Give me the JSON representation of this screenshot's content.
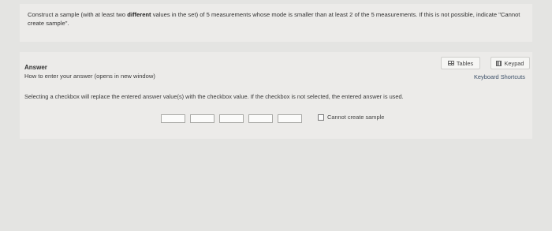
{
  "question": {
    "text_before_bold": "Construct a sample (with at least two ",
    "text_bold": "different",
    "text_after_bold": " values in the set) of 5 measurements whose mode is smaller than at least 2 of the 5 measurements.  If this is not possible, indicate \"Cannot create sample\"."
  },
  "answer": {
    "heading": "Answer",
    "howto_link": "How to enter your answer (opens in new window)",
    "tables_label": "Tables",
    "keypad_label": "Keypad",
    "keyboard_shortcuts": "Keyboard Shortcuts",
    "instructions": "Selecting a checkbox will replace the entered answer value(s) with the checkbox value. If the checkbox is not selected, the entered answer is used.",
    "inputs": [
      "",
      "",
      "",
      "",
      ""
    ],
    "checkbox_label": "Cannot create sample",
    "checkbox_checked": false
  }
}
